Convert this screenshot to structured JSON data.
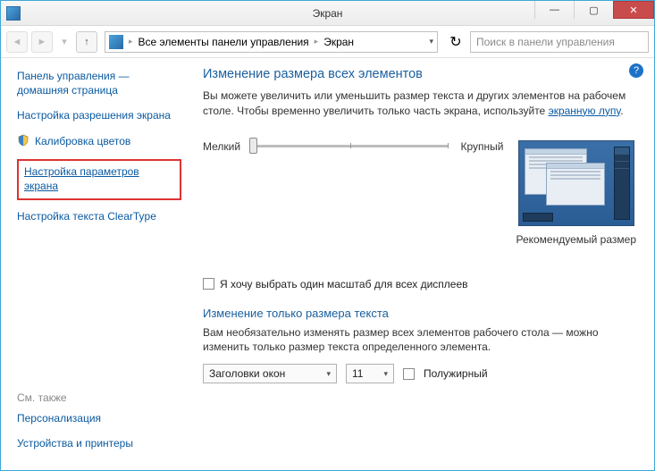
{
  "window": {
    "title": "Экран"
  },
  "nav": {
    "breadcrumb": {
      "root": "Все элементы панели управления",
      "leaf": "Экран"
    },
    "search_placeholder": "Поиск в панели управления"
  },
  "sidebar": {
    "home_link": "Панель управления — домашняя страница",
    "items": [
      {
        "label": "Настройка разрешения экрана"
      },
      {
        "label": "Калибровка цветов",
        "shield": true
      },
      {
        "label": "Настройка параметров экрана",
        "highlight": true
      },
      {
        "label": "Настройка текста ClearType"
      }
    ],
    "seealso_header": "См. также",
    "seealso": [
      {
        "label": "Персонализация"
      },
      {
        "label": "Устройства и принтеры"
      }
    ]
  },
  "main": {
    "heading": "Изменение размера всех элементов",
    "desc_pre": "Вы можете увеличить или уменьшить размер текста и других элементов на рабочем столе. Чтобы временно увеличить только часть экрана, используйте ",
    "desc_link": "экранную лупу",
    "slider": {
      "min_label": "Мелкий",
      "max_label": "Крупный",
      "position": 0
    },
    "recommended_label": "Рекомендуемый размер",
    "one_scale_checkbox": "Я хочу выбрать один масштаб для всех дисплеев",
    "text_heading": "Изменение только размера текста",
    "text_desc": "Вам необязательно изменять размер всех элементов рабочего стола — можно изменить только размер текста определенного элемента.",
    "element_dd": {
      "value": "Заголовки окон"
    },
    "size_dd": {
      "value": "11"
    },
    "bold_checkbox": "Полужирный"
  }
}
